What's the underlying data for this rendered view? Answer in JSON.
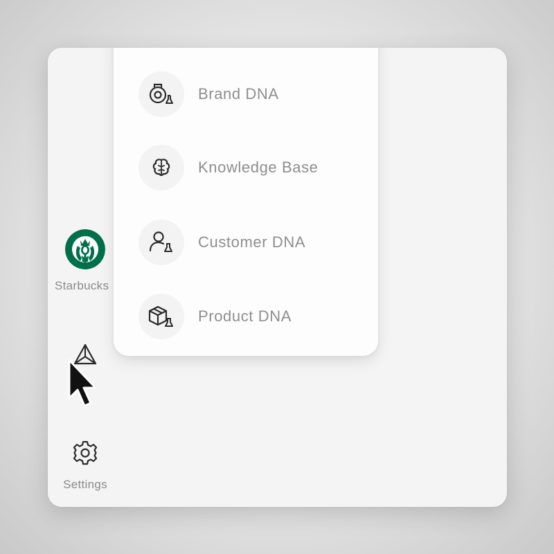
{
  "workspace": {
    "name": "Starbucks",
    "logo_icon": "starbucks-siren-logo",
    "logo_color": "#00704a"
  },
  "sidebar": {
    "dna_icon": "dna-triangle-icon",
    "settings_icon": "gear-icon",
    "settings_label": "Settings"
  },
  "menu": {
    "items": [
      {
        "label": "Brand DNA",
        "icon": "brand-dna-icon"
      },
      {
        "label": "Knowledge Base",
        "icon": "brain-icon"
      },
      {
        "label": "Customer DNA",
        "icon": "customer-dna-icon"
      },
      {
        "label": "Product DNA",
        "icon": "product-dna-icon"
      }
    ]
  },
  "colors": {
    "text_muted": "#8e8e8e",
    "icon_stroke": "#2b2b2b",
    "panel_bg": "#fdfdfd",
    "window_bg": "#f4f4f4"
  }
}
